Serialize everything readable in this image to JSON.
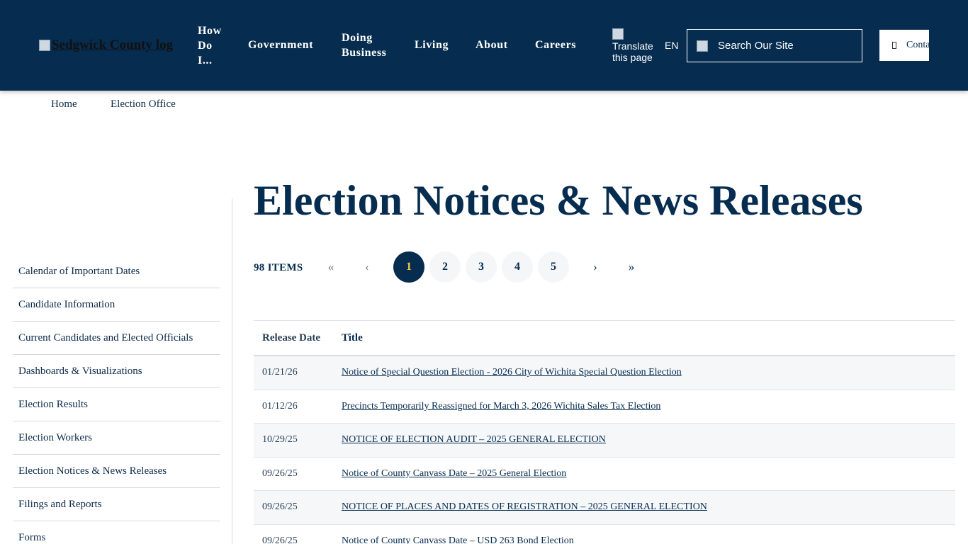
{
  "header": {
    "logo_alt": "Sedgwick County logo",
    "nav": [
      "How Do I...",
      "Government",
      "Doing Business",
      "Living",
      "About",
      "Careers"
    ],
    "translate_label": "Translate this page",
    "language": "EN",
    "search_placeholder": "Search Our Site",
    "contact_label": "Contact"
  },
  "breadcrumb": [
    "Home",
    "Election Office"
  ],
  "sidebar": {
    "items": [
      "Calendar of Important Dates",
      "Candidate Information",
      "Current Candidates and Elected Officials",
      "Dashboards & Visualizations",
      "Election Results",
      "Election Workers",
      "Election Notices & News Releases",
      "Filings and Reports",
      "Forms"
    ]
  },
  "main": {
    "title": "Election Notices & News Releases",
    "item_count": "98 ITEMS",
    "pagination": {
      "first": "«",
      "prev": "‹",
      "pages": [
        "1",
        "2",
        "3",
        "4",
        "5"
      ],
      "current": "1",
      "next": "›",
      "last": "»"
    },
    "table": {
      "headers": [
        "Release Date",
        "Title"
      ],
      "rows": [
        {
          "date": "01/21/26",
          "title": "Notice of Special Question Election - 2026 City of Wichita Special Question Election"
        },
        {
          "date": "01/12/26",
          "title": "Precincts Temporarily Reassigned for March 3, 2026 Wichita Sales Tax Election"
        },
        {
          "date": "10/29/25",
          "title": "NOTICE OF ELECTION AUDIT – 2025 GENERAL ELECTION"
        },
        {
          "date": "09/26/25",
          "title": "Notice of County Canvass Date – 2025 General Election"
        },
        {
          "date": "09/26/25",
          "title": "NOTICE OF PLACES AND DATES OF REGISTRATION – 2025 GENERAL ELECTION"
        },
        {
          "date": "09/26/25",
          "title": "Notice of County Canvass Date – USD 263 Bond Election"
        }
      ]
    }
  },
  "colors": {
    "navy": "#062c4f",
    "active_page_text": "#f2c94c"
  }
}
